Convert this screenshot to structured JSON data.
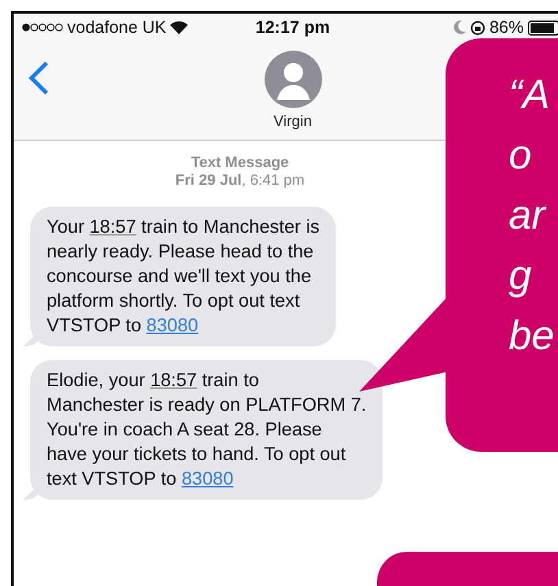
{
  "status_bar": {
    "carrier": "vodafone UK",
    "time": "12:17 pm",
    "battery": "86%"
  },
  "header": {
    "contact": "Virgin"
  },
  "thread": {
    "service": "Text Message",
    "date": "Fri 29 Jul, 6:41 pm"
  },
  "messages": [
    {
      "parts": [
        {
          "kind": "text",
          "text": "Your "
        },
        {
          "kind": "time",
          "text": "18:57"
        },
        {
          "kind": "text",
          "text": " train to Manchester is\nnearly ready. Please head to the\nconcourse and we'll text you the\nplatform shortly. To opt out text\nVTSTOP to "
        },
        {
          "kind": "link",
          "text": "83080"
        }
      ]
    },
    {
      "parts": [
        {
          "kind": "text",
          "text": "Elodie, your "
        },
        {
          "kind": "time",
          "text": "18:57"
        },
        {
          "kind": "text",
          "text": " train to\nManchester is ready on PLATFORM 7.\nYou're in coach A seat 28. Please\nhave your tickets to hand. To opt out\ntext VTSTOP to "
        },
        {
          "kind": "link",
          "text": "83080"
        }
      ]
    }
  ],
  "callouts": [
    {
      "kind": "pointer",
      "lines": [
        "“A",
        "o",
        "ar",
        "g",
        "be"
      ]
    },
    {
      "kind": "plain"
    }
  ]
}
